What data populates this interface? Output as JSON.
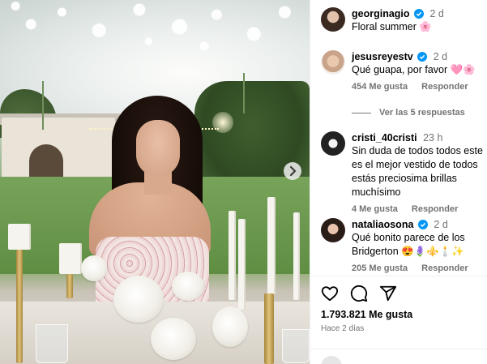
{
  "post": {
    "next_label": "›"
  },
  "comments": [
    {
      "username": "georginagio",
      "verified": true,
      "time": "2 d",
      "text": "Floral summer 🌸"
    },
    {
      "username": "jesusreyestv",
      "verified": true,
      "time": "2 d",
      "text": "Qué guapa, por favor 🩷🌸",
      "likes": "454 Me gusta",
      "reply": "Responder"
    },
    {
      "username": "cristi_40cristi",
      "verified": false,
      "time": "23 h",
      "text": "Sin duda de todos todos este es el mejor vestido de todos estás preciosima brillas muchísimo",
      "likes": "4 Me gusta",
      "reply": "Responder"
    },
    {
      "username": "nataliaosona",
      "verified": true,
      "time": "2 d",
      "text": "Qué bonito parece de los Bridgerton 😍🪻⚜️🕯️✨",
      "likes": "205 Me gusta",
      "reply": "Responder"
    }
  ],
  "view_replies": "Ver las 5 respuestas",
  "likes_total": "1.793.821 Me gusta",
  "posted_ago": "Hace 2 días",
  "colors": {
    "verified": "#0095f6",
    "secondary_text": "#737373",
    "divider": "#efefef"
  },
  "icons": [
    "heart-icon",
    "comment-icon",
    "share-icon",
    "verified-badge-icon",
    "chevron-right-icon"
  ]
}
